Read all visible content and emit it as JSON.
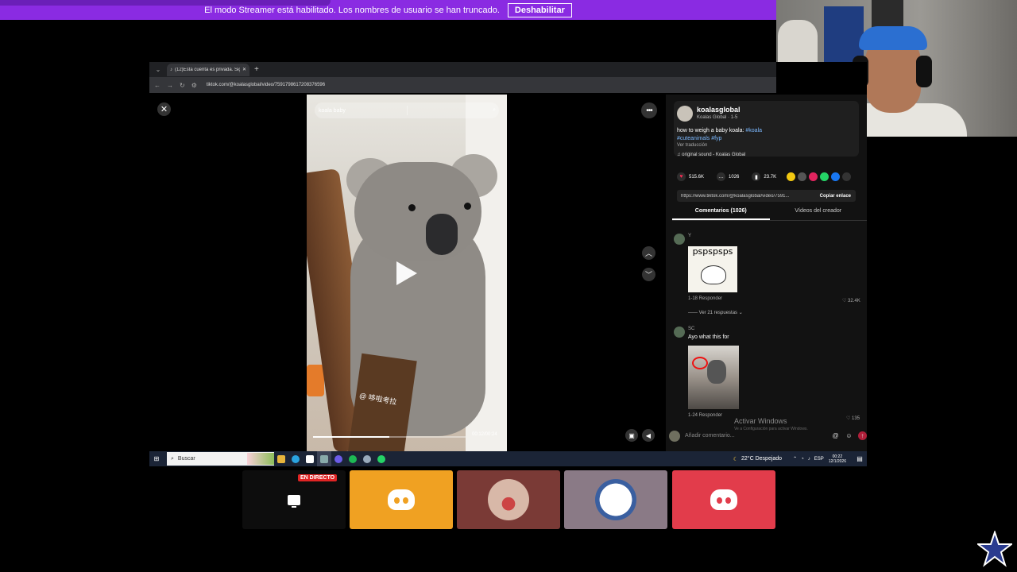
{
  "banner": {
    "message": "El modo Streamer está habilitado. Los nombres de usuario se han truncado.",
    "button": "Deshabilitar"
  },
  "browser": {
    "tab_title": "(12)Esta cuenta es privada. Sig...",
    "new_tab": "+",
    "url": "tiktok.com/@koalasglobal/video/7591798617208376596"
  },
  "video": {
    "search_placeholder": "koala baby",
    "time": "00:12/00:24",
    "watermark": "@ 哆啦考拉",
    "progress_percent": 50
  },
  "post": {
    "handle": "koalasglobal",
    "subline": "Koalas Global · 1-5",
    "description": "how to weigh a baby koala: ",
    "tag1": "#koala",
    "tag2": "#cuteanimals",
    "tag3": "#fyp",
    "translate": "Ver traducción",
    "sound": "♫ original sound - Koalas Global",
    "likes": "515.6K",
    "comments": "1026",
    "saves": "23.7K",
    "link": "https://www.tiktok.com/@koalasglobal/video/7591...",
    "copy": "Copiar enlace"
  },
  "tabs": {
    "comments": "Comentarios (1026)",
    "creator_videos": "Vídeos del creador"
  },
  "comments": [
    {
      "name": "Y",
      "meme_text": "pspspsps",
      "meta": "1-18    Responder",
      "likes": "♡ 32.4K",
      "replies": "—— Ver 21 respuestas ⌄"
    },
    {
      "name": "SC",
      "text": "Ayo what this for",
      "meta": "1-24    Responder",
      "likes": "♡ 135"
    }
  ],
  "windows_watermark": {
    "title": "Activar Windows",
    "sub": "Ve a Configuración para activar Windows."
  },
  "comment_input": {
    "placeholder": "Añadir comentario..."
  },
  "taskbar": {
    "search": "Buscar",
    "weather": "22°C  Despejado",
    "lang": "ESP",
    "time": "00:22",
    "date": "12/1/2026"
  },
  "discord": {
    "live_label": "EN DIRECTO"
  },
  "colors": {
    "banner": "#8a2be2",
    "tile2": "#f0a122",
    "tile3": "#7a3a36",
    "tile4": "#8a7a86",
    "tile5": "#e23c4b"
  }
}
